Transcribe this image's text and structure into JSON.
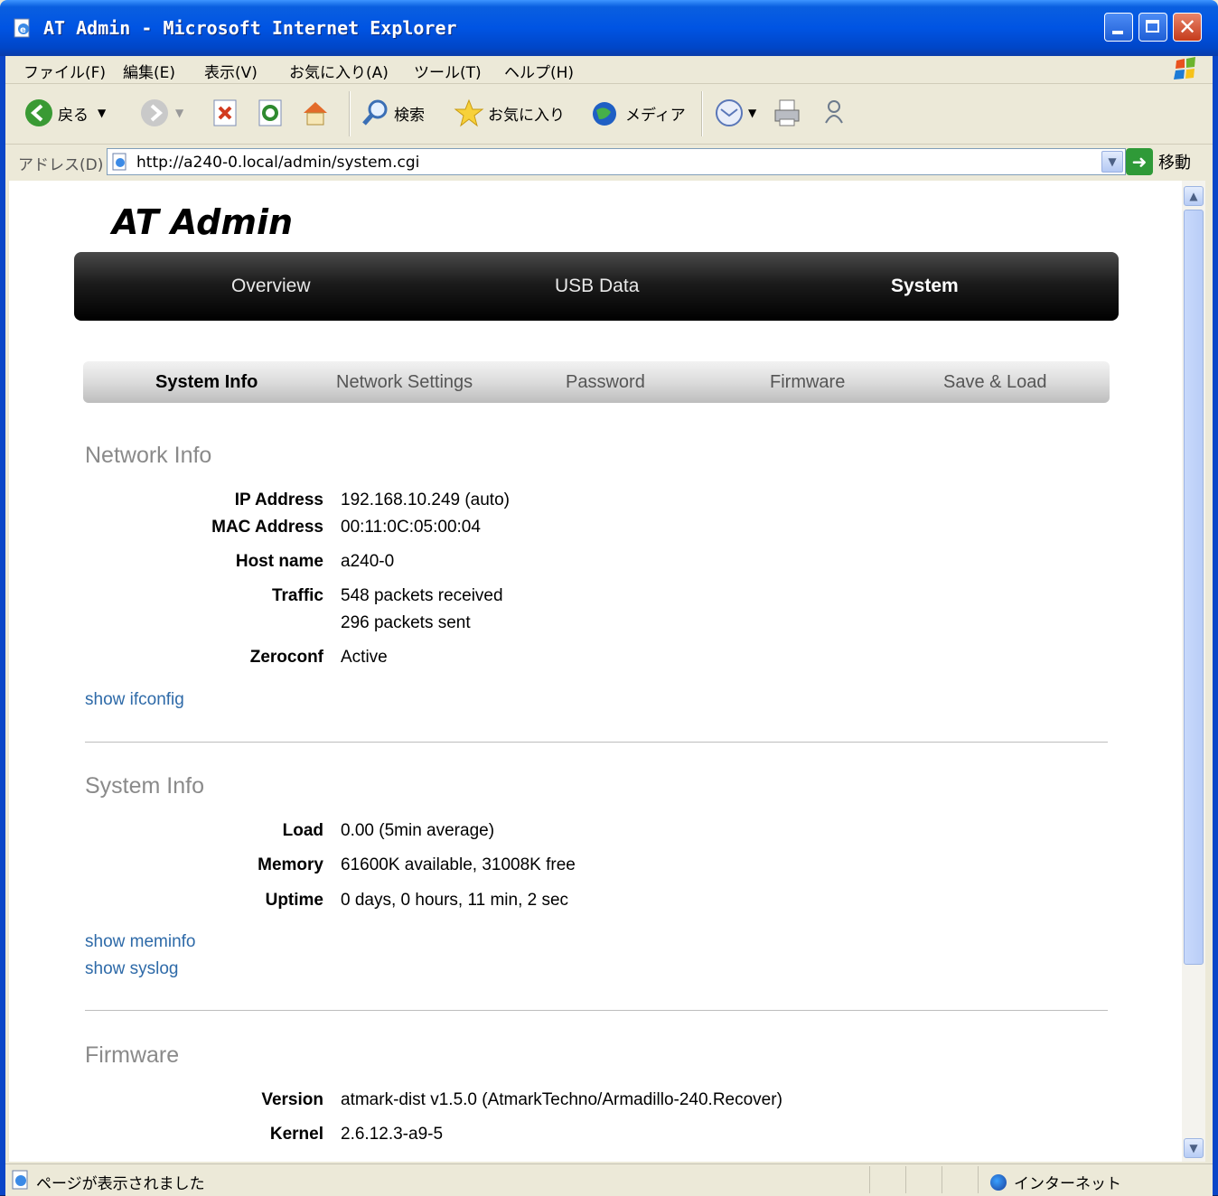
{
  "window": {
    "title": "AT Admin - Microsoft Internet Explorer"
  },
  "menubar": {
    "items": [
      "ファイル(F)",
      "編集(E)",
      "表示(V)",
      "お気に入り(A)",
      "ツール(T)",
      "ヘルプ(H)"
    ]
  },
  "toolbar": {
    "back_label": "戻る",
    "search_label": "検索",
    "favorites_label": "お気に入り",
    "media_label": "メディア"
  },
  "addressbar": {
    "label": "アドレス(D)",
    "url": "http://a240-0.local/admin/system.cgi",
    "go_label": "移動"
  },
  "statusbar": {
    "text": "ページが表示されました",
    "zone": "インターネット"
  },
  "page": {
    "site_title": "AT Admin",
    "main_nav": [
      "Overview",
      "USB Data",
      "System"
    ],
    "main_nav_active": "System",
    "sub_nav": [
      "System Info",
      "Network Settings",
      "Password",
      "Firmware",
      "Save & Load"
    ],
    "sub_nav_active": "System Info",
    "network": {
      "heading": "Network Info",
      "ip_label": "IP Address",
      "ip_value": "192.168.10.249 (auto)",
      "mac_label": "MAC Address",
      "mac_value": "00:11:0C:05:00:04",
      "host_label": "Host name",
      "host_value": "a240-0",
      "traffic_label": "Traffic",
      "traffic_rx": "548 packets received",
      "traffic_tx": "296 packets sent",
      "zeroconf_label": "Zeroconf",
      "zeroconf_value": "Active",
      "link_ifconfig": "show ifconfig"
    },
    "system": {
      "heading": "System Info",
      "load_label": "Load",
      "load_value": "0.00 (5min average)",
      "memory_label": "Memory",
      "memory_value": "61600K available, 31008K free",
      "uptime_label": "Uptime",
      "uptime_value": "0 days, 0 hours, 11 min, 2 sec",
      "link_meminfo": "show meminfo",
      "link_syslog": "show syslog"
    },
    "firmware": {
      "heading": "Firmware",
      "version_label": "Version",
      "version_value": "atmark-dist v1.5.0 (AtmarkTechno/Armadillo-240.Recover)",
      "kernel_label": "Kernel",
      "kernel_value": "2.6.12.3-a9-5"
    }
  },
  "colors": {
    "titlebar": "#0054e3",
    "link": "#2e6aa8",
    "section_heading": "#8a8a8a"
  }
}
